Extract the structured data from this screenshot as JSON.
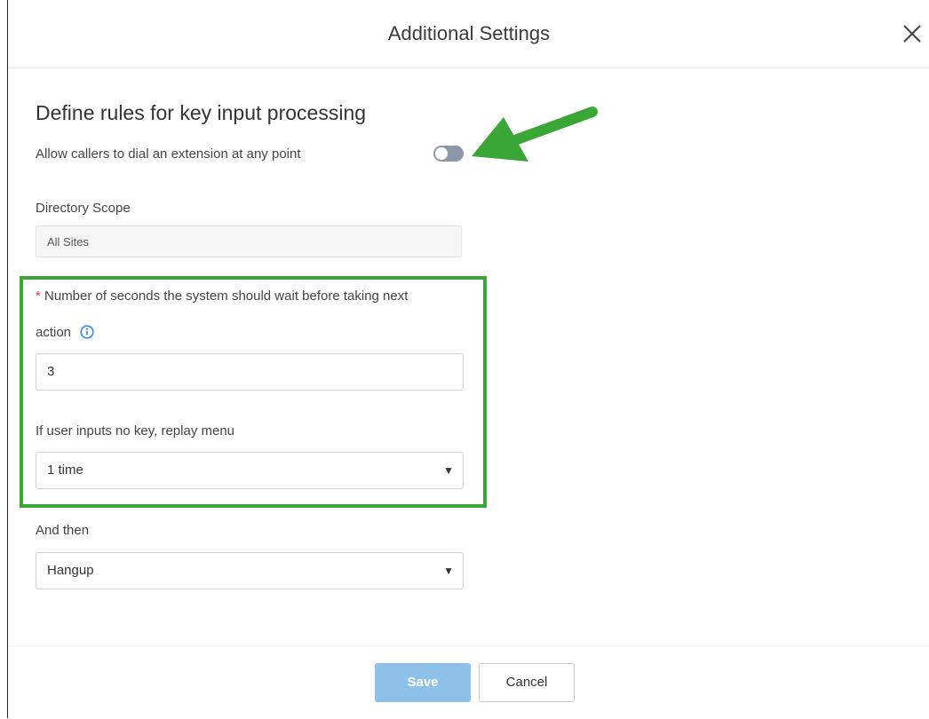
{
  "dialog": {
    "title": "Additional Settings"
  },
  "section": {
    "title": "Define rules for key input processing"
  },
  "dial_extension": {
    "label": "Allow callers to dial an extension at any point",
    "enabled": false
  },
  "directory_scope": {
    "label": "Directory Scope",
    "value": "All Sites"
  },
  "wait_seconds": {
    "required_mark": "*",
    "label_line1": "Number of seconds the system should wait before taking next",
    "label_line2": "action",
    "value": "3"
  },
  "replay_menu": {
    "label": "If user inputs no key, replay menu",
    "value": "1 time"
  },
  "and_then": {
    "label": "And then",
    "value": "Hangup"
  },
  "footer": {
    "save_label": "Save",
    "cancel_label": "Cancel"
  },
  "colors": {
    "highlight": "#3aa635",
    "arrow": "#3aa635",
    "save_button": "#8dc1ea",
    "toggle_off": "#8c98a8",
    "info_icon": "#2f8fde",
    "required": "#e04040"
  }
}
